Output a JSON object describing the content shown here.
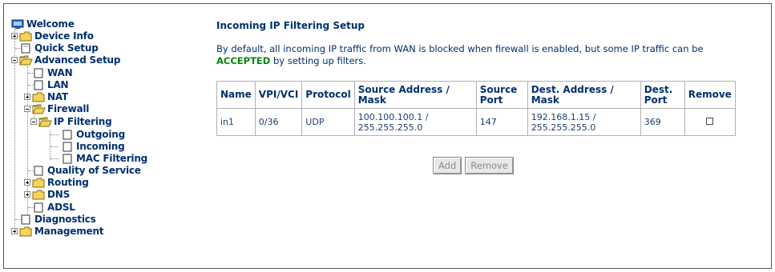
{
  "nav": {
    "welcome": "Welcome",
    "device_info": "Device Info",
    "quick_setup": "Quick Setup",
    "advanced_setup": "Advanced Setup",
    "wan": "WAN",
    "lan": "LAN",
    "nat": "NAT",
    "firewall": "Firewall",
    "ip_filtering": "IP Filtering",
    "outgoing": "Outgoing",
    "incoming": "Incoming",
    "mac_filtering": "MAC Filtering",
    "qos": "Quality of Service",
    "routing": "Routing",
    "dns": "DNS",
    "adsl": "ADSL",
    "diagnostics": "Diagnostics",
    "management": "Management"
  },
  "page": {
    "title": "Incoming IP Filtering Setup",
    "description_pre": "By default, all incoming IP traffic from WAN is blocked when firewall is enabled, but some IP traffic can be ",
    "description_accent": "ACCEPTED",
    "description_post": " by setting up filters."
  },
  "table": {
    "headers": [
      "Name",
      "VPI/VCI",
      "Protocol",
      "Source Address / Mask",
      "Source Port",
      "Dest. Address / Mask",
      "Dest. Port",
      "Remove"
    ],
    "rows": [
      {
        "name": "in1",
        "vpivci": "0/36",
        "protocol": "UDP",
        "src": "100.100.100.1 / 255.255.255.0",
        "src_port": "147",
        "dst": "192.168.1.15 / 255.255.255.0",
        "dst_port": "369",
        "remove_checked": false
      }
    ]
  },
  "buttons": {
    "add": "Add",
    "remove": "Remove"
  },
  "colors": {
    "nav_text": "#00306e",
    "accent_green": "#08870a",
    "folder": "#f4d35e"
  }
}
